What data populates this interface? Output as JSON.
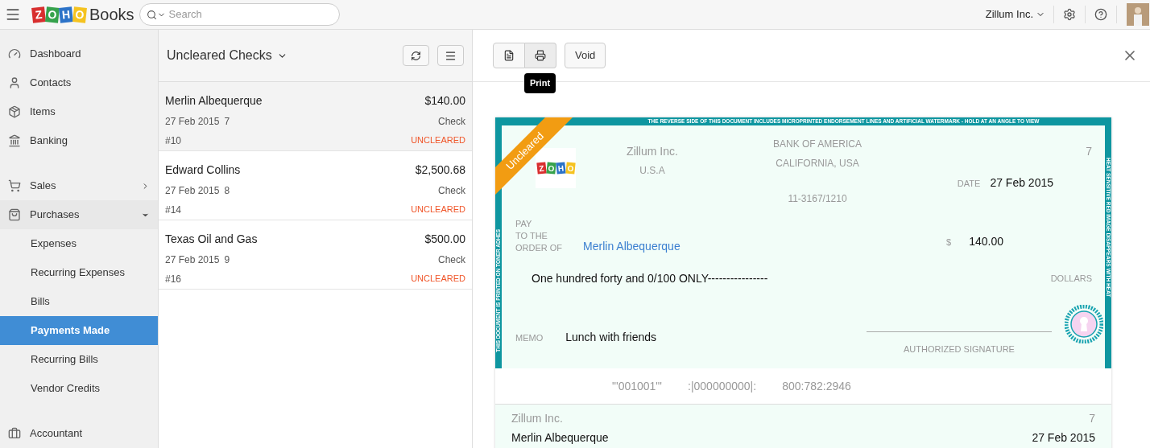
{
  "topbar": {
    "brand_letters": [
      "Z",
      "O",
      "H",
      "O"
    ],
    "brand_name": "Books",
    "search": {
      "placeholder": "Search"
    },
    "organization": "Zillum Inc."
  },
  "sidebar": {
    "items": [
      {
        "label": "Dashboard",
        "selected": false
      },
      {
        "label": "Contacts",
        "selected": false
      },
      {
        "label": "Items",
        "selected": false
      },
      {
        "label": "Banking",
        "selected": false
      },
      {
        "label": "Sales",
        "selected": false,
        "expanded": false
      },
      {
        "label": "Purchases",
        "selected": false,
        "expanded": true,
        "children": [
          {
            "label": "Expenses",
            "selected": false
          },
          {
            "label": "Recurring Expenses",
            "selected": false
          },
          {
            "label": "Bills",
            "selected": false
          },
          {
            "label": "Payments Made",
            "selected": true
          },
          {
            "label": "Recurring Bills",
            "selected": false
          },
          {
            "label": "Vendor Credits",
            "selected": false
          }
        ]
      },
      {
        "label": "Accountant",
        "selected": false
      }
    ]
  },
  "list": {
    "title": "Uncleared Checks",
    "rows": [
      {
        "name": "Merlin Albequerque",
        "amount": "$140.00",
        "date": "27 Feb 2015",
        "check_no": "7",
        "type": "Check",
        "ref": "#10",
        "status": "UNCLEARED",
        "selected": true
      },
      {
        "name": "Edward Collins",
        "amount": "$2,500.68",
        "date": "27 Feb 2015",
        "check_no": "8",
        "type": "Check",
        "ref": "#14",
        "status": "UNCLEARED",
        "selected": false
      },
      {
        "name": "Texas Oil and Gas",
        "amount": "$500.00",
        "date": "27 Feb 2015",
        "check_no": "9",
        "type": "Check",
        "ref": "#16",
        "status": "UNCLEARED",
        "selected": false
      }
    ]
  },
  "detail": {
    "void_button": "Void",
    "tooltip": "Print",
    "check": {
      "ribbon": "Uncleared",
      "top_border": "THE REVERSE SIDE OF THIS DOCUMENT INCLUDES MICROPRINTED ENDORSEMENT LINES AND ARTIFICIAL WATERMARK - HOLD AT AN ANGLE TO VIEW",
      "left_border": "THIS DOCUMENT IS PRINTED ON TONER ADHES",
      "right_border": "HEAT SENSITIVE RED IMAGE DISAPPEARS WITH HEAT",
      "logo_letters": [
        "Z",
        "O",
        "H",
        "O"
      ],
      "company": "Zillum Inc.",
      "country": "U.S.A",
      "bank": "BANK OF AMERICA",
      "bank_location": "CALIFORNIA, USA",
      "routing": "11-3167/1210",
      "number": "7",
      "date_label": "DATE",
      "date": "27 Feb 2015",
      "pay_label": [
        "PAY",
        "TO THE",
        "ORDER OF"
      ],
      "payee": "Merlin Albequerque",
      "currency": "$",
      "amount": "140.00",
      "amount_words": "One hundred forty and 0/100 ONLY----------------",
      "dollars_label": "DOLLARS",
      "memo_label": "MEMO",
      "memo": "Lunch with friends",
      "signature_label": "AUTHORIZED SIGNATURE",
      "micr": [
        "\"'001001\"'",
        ":|000000000|:",
        "800:782:2946"
      ]
    },
    "stub": {
      "company": "Zillum Inc.",
      "number": "7",
      "payee": "Merlin Albequerque",
      "date": "27 Feb 2015"
    }
  }
}
